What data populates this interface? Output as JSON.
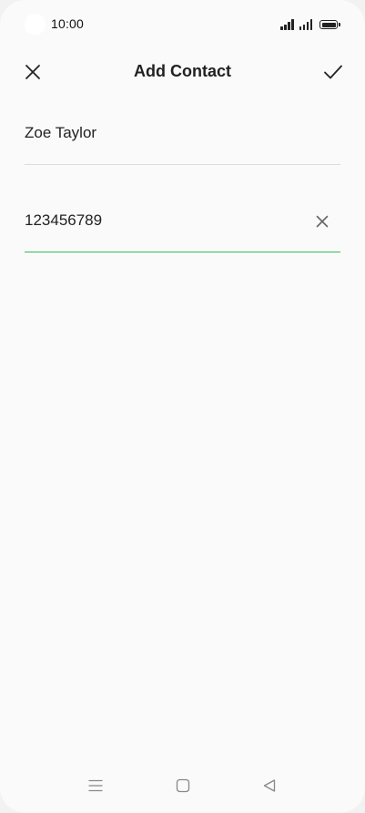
{
  "status_bar": {
    "time": "10:00",
    "icons": [
      "signal-icon",
      "signal-icon",
      "battery-icon"
    ]
  },
  "header": {
    "title": "Add Contact",
    "close_icon": "close-icon",
    "confirm_icon": "check-icon"
  },
  "form": {
    "name_value": "Zoe Taylor",
    "phone_value": "123456789",
    "clear_icon": "clear-icon"
  },
  "nav_bar": {
    "icons": [
      "menu-icon",
      "home-icon",
      "back-icon"
    ]
  },
  "colors": {
    "background": "#fafafa",
    "active_underline": "#2fbf4f",
    "divider": "#dcdcdc",
    "text": "#222222"
  }
}
